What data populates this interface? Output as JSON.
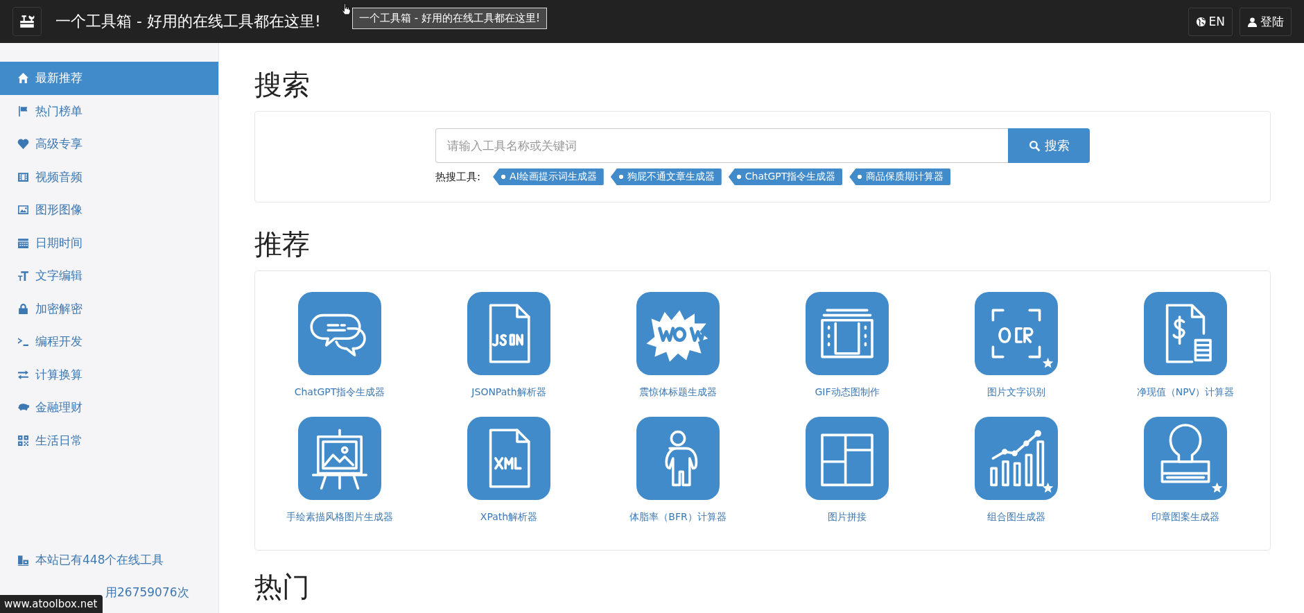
{
  "header": {
    "title": "一个工具箱 - 好用的在线工具都在这里!",
    "tooltip": "一个工具箱 - 好用的在线工具都在这里!",
    "buttons": [
      "EN",
      "登陆"
    ]
  },
  "sidebar": {
    "items": [
      {
        "label": "最新推荐",
        "selected": true
      },
      {
        "label": "热门榜单",
        "selected": false
      },
      {
        "label": "高级专享",
        "selected": false
      },
      {
        "label": "视频音频",
        "selected": false
      },
      {
        "label": "图形图像",
        "selected": false
      },
      {
        "label": "日期时间",
        "selected": false
      },
      {
        "label": "文字编辑",
        "selected": false
      },
      {
        "label": "加密解密",
        "selected": false
      },
      {
        "label": "编程开发",
        "selected": false
      },
      {
        "label": "计算换算",
        "selected": false
      },
      {
        "label": "金融理财",
        "selected": false
      },
      {
        "label": "生活日常",
        "selected": false
      }
    ],
    "stats": [
      "本站已有448个在线工具",
      "用26759076次"
    ]
  },
  "status_url": "www.atoolbox.net",
  "search": {
    "heading": "搜索",
    "placeholder": "请输入工具名称或关键词",
    "button": "搜索",
    "hot_label": "热搜工具:",
    "hot_tags": [
      "AI绘画提示词生成器",
      "狗屁不通文章生成器",
      "ChatGPT指令生成器",
      "商品保质期计算器"
    ]
  },
  "recommended": {
    "heading": "推荐",
    "tools": [
      {
        "name": "ChatGPT指令生成器",
        "starred": false
      },
      {
        "name": "JSONPath解析器",
        "starred": false
      },
      {
        "name": "震惊体标题生成器",
        "starred": false
      },
      {
        "name": "GIF动态图制作",
        "starred": false
      },
      {
        "name": "图片文字识别",
        "starred": true
      },
      {
        "name": "净现值（NPV）计算器",
        "starred": false
      },
      {
        "name": "手绘素描风格图片生成器",
        "starred": false
      },
      {
        "name": "XPath解析器",
        "starred": false
      },
      {
        "name": "体脂率（BFR）计算器",
        "starred": false
      },
      {
        "name": "图片拼接",
        "starred": false
      },
      {
        "name": "组合图生成器",
        "starred": true
      },
      {
        "name": "印章图案生成器",
        "starred": true
      }
    ]
  },
  "hot": {
    "heading": "热门"
  }
}
